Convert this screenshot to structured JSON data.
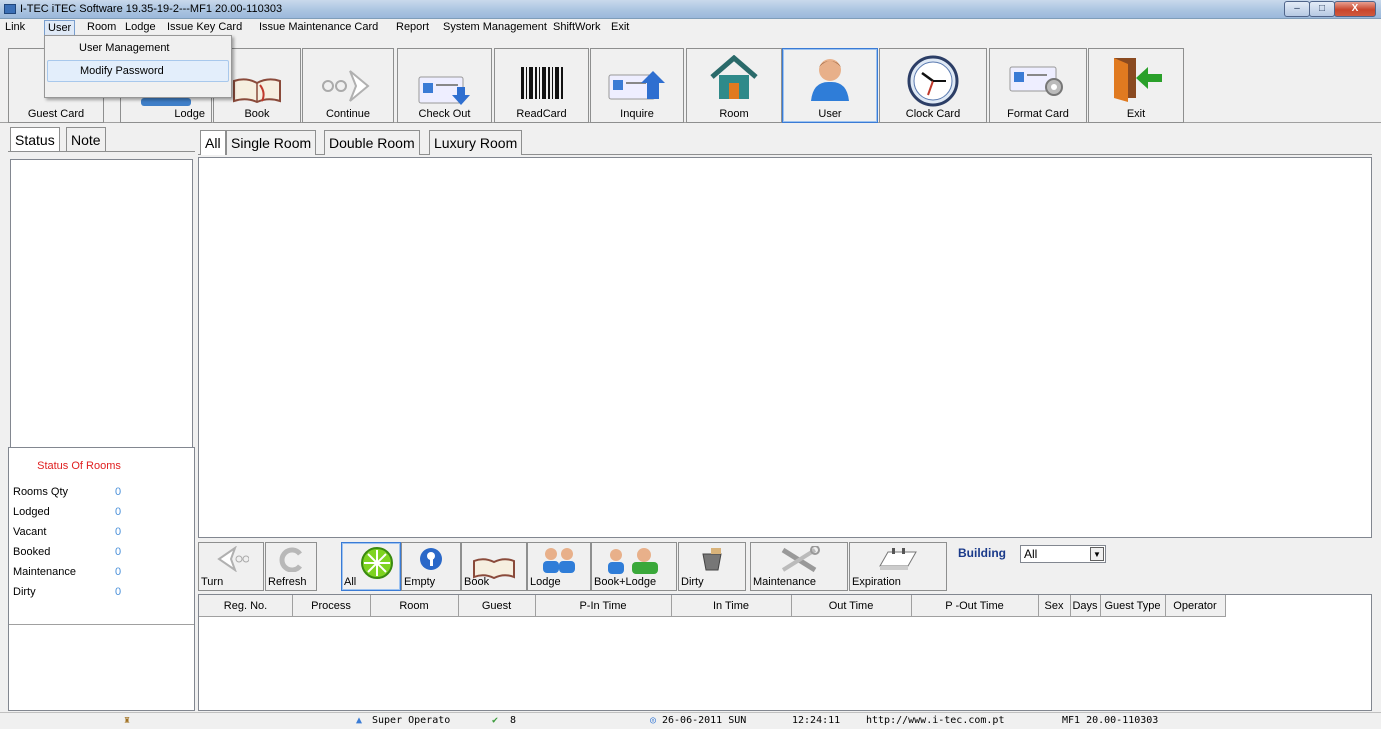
{
  "window": {
    "title": "I-TEC iTEC Software 19.35-19-2---MF1 20.00-110303",
    "minimize": "–",
    "maximize": "□",
    "close": "X"
  },
  "menu": [
    "Link",
    "User",
    "Room",
    "Lodge",
    "Issue Key Card",
    "Issue Maintenance Card",
    "Report",
    "System Management",
    "ShiftWork",
    "Exit"
  ],
  "user_menu": [
    "User Management",
    "Modify Password"
  ],
  "toolbar": [
    "Guest Card",
    "Lodge",
    "Book",
    "Continue",
    "Check Out",
    "ReadCard",
    "Inquire",
    "Room",
    "User",
    "Clock Card",
    "Format Card",
    "Exit"
  ],
  "left_tabs": [
    "Status",
    "Note"
  ],
  "status_of_rooms": {
    "title": "Status Of Rooms",
    "rows": [
      {
        "label": "Rooms Qty",
        "value": "0"
      },
      {
        "label": "Lodged",
        "value": "0"
      },
      {
        "label": "Vacant",
        "value": "0"
      },
      {
        "label": "Booked",
        "value": "0"
      },
      {
        "label": "Maintenance",
        "value": "0"
      },
      {
        "label": "Dirty",
        "value": "0"
      }
    ]
  },
  "room_tabs": [
    "All",
    "Single Room",
    "Double Room",
    "Luxury Room"
  ],
  "filter_buttons": [
    "Turn",
    "Refresh",
    "All",
    "Empty",
    "Book",
    "Lodge",
    "Book+Lodge",
    "Dirty",
    "Maintenance",
    "Expiration"
  ],
  "building": {
    "label": "Building",
    "value": "All"
  },
  "grid_columns": [
    "Reg. No.",
    "Process",
    "Room",
    "Guest",
    "P-In Time",
    "In Time",
    "Out Time",
    "P -Out Time",
    "Sex",
    "Days",
    "Guest Type",
    "Operator"
  ],
  "statusbar": {
    "user": "Super Operato",
    "count": "8",
    "date": "26-06-2011 SUN",
    "time": "12:24:11",
    "url": "http://www.i-tec.com.pt",
    "version": "MF1 20.00-110303"
  }
}
